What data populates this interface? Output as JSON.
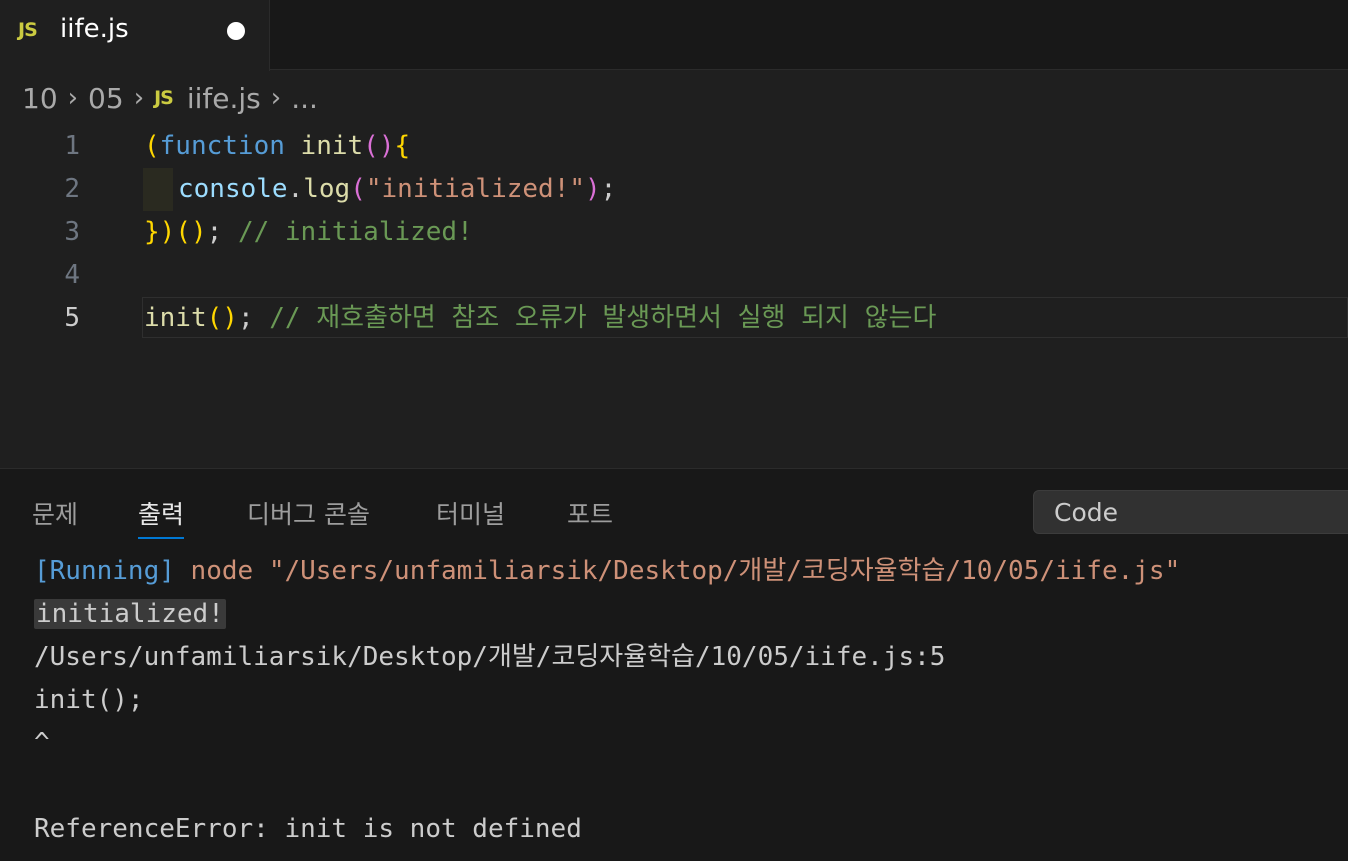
{
  "tab": {
    "icon": "JS",
    "name": "iife.js"
  },
  "breadcrumb": {
    "parts": [
      "10",
      "05"
    ],
    "file_icon": "JS",
    "file": "iife.js",
    "more": "..."
  },
  "editor": {
    "line_numbers": [
      "1",
      "2",
      "3",
      "4",
      "5"
    ],
    "line1": {
      "open_paren": "(",
      "keyword": "function",
      "name": "init",
      "parens": "()",
      "brace": "{"
    },
    "line2": {
      "obj": "console",
      "dot": ".",
      "method": "log",
      "open": "(",
      "string": "\"initialized!\"",
      "close": ")",
      "semi": ";"
    },
    "line3": {
      "brace": "}",
      "close": ")",
      "call": "()",
      "semi": ";",
      "comment": "// initialized!"
    },
    "line5": {
      "name": "init",
      "call": "()",
      "semi": ";",
      "comment": "// 재호출하면 참조 오류가 발생하면서 실행 되지 않는다"
    }
  },
  "panel": {
    "tabs": [
      "문제",
      "출력",
      "디버그 콘솔",
      "터미널",
      "포트"
    ],
    "active_tab": "출력",
    "dropdown_value": "Code",
    "output": {
      "running_tag": "[Running]",
      "running_cmd": "node \"/Users/unfamiliarsik/Desktop/개발/코딩자율학습/10/05/iife.js\"",
      "line2": "initialized!",
      "line3": "/Users/unfamiliarsik/Desktop/개발/코딩자율학습/10/05/iife.js:5",
      "line4": "init();",
      "line5": "^",
      "line7": "ReferenceError: init is not defined"
    }
  }
}
